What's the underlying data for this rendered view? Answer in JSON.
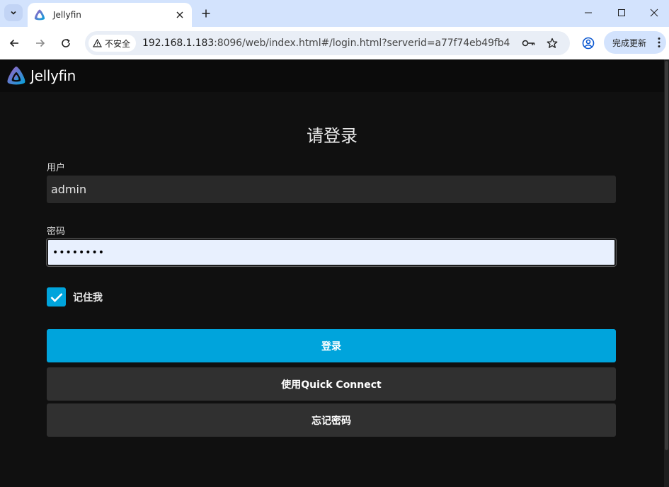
{
  "browser": {
    "tab_title": "Jellyfin",
    "security_label": "不安全",
    "url_host": "192.168.1.183",
    "url_rest": ":8096/web/index.html#/login.html?serverid=a77f74eb49fb431...",
    "update_label": "完成更新"
  },
  "app": {
    "brand": "Jellyfin",
    "accent_color": "#00a4dc"
  },
  "login": {
    "title": "请登录",
    "user_label": "用户",
    "user_value": "admin",
    "password_label": "密码",
    "password_value": "••••••••",
    "remember_label": "记住我",
    "remember_checked": true,
    "login_button": "登录",
    "quick_connect_button": "使用Quick Connect",
    "forgot_button": "忘记密码"
  }
}
